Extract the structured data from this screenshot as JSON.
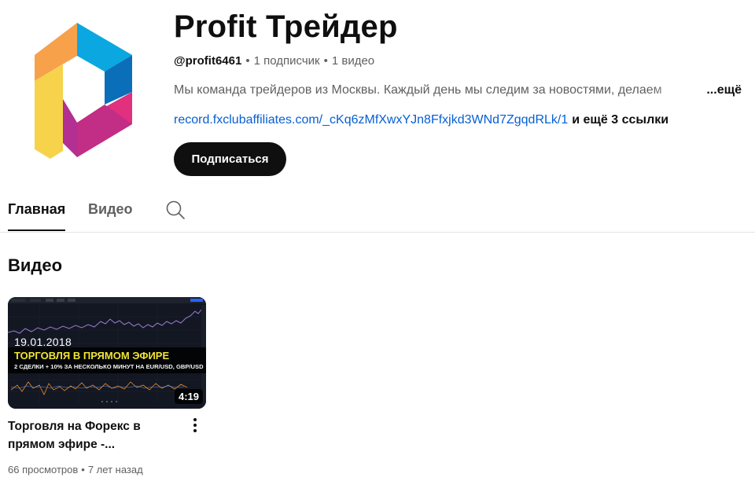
{
  "channel": {
    "name": "Profit Трейдер",
    "handle": "@profit6461",
    "subscribers": "1 подписчик",
    "videos_count": "1 видео",
    "separator": "•",
    "description": "Мы команда трейдеров из Москвы. Каждый день мы следим за новостями, делаем",
    "description_more": "...ещё",
    "link": "record.fxclubaffiliates.com/_cKq6zMfXwxYJn8Ffxjkd3WNd7ZgqdRLk/1",
    "more_links": "и ещё 3 ссылки",
    "subscribe_label": "Подписаться",
    "logo_colors": {
      "blue": "#0aa7e1",
      "dark_blue": "#0a6fb8",
      "orange": "#f7a14a",
      "yellow": "#f6d34a",
      "pink": "#e0307e",
      "magenta": "#b32f91"
    }
  },
  "tabs": [
    {
      "label": "Главная",
      "active": true
    },
    {
      "label": "Видео",
      "active": false
    }
  ],
  "icons": {
    "search": "search-icon",
    "more": "more-vert-icon"
  },
  "section": {
    "title": "Видео"
  },
  "videos": [
    {
      "thumbnail": {
        "date": "19.01.2018",
        "headline": "ТОРГОВЛЯ В ПРЯМОМ ЭФИРЕ",
        "subline": "2 СДЕЛКИ + 10% ЗА НЕСКОЛЬКО МИНУТ НА EUR/USD, GBP/USD"
      },
      "duration": "4:19",
      "title": "Торговля на Форекс в прямом эфире -...",
      "views": "66 просмотров",
      "published": "7 лет назад"
    }
  ],
  "colors": {
    "text_primary": "#0f0f0f",
    "text_secondary": "#606060",
    "link": "#065fd4",
    "button_bg": "#0f0f0f",
    "thumb_bg": "#131722",
    "headline_yellow": "#f0e531"
  }
}
